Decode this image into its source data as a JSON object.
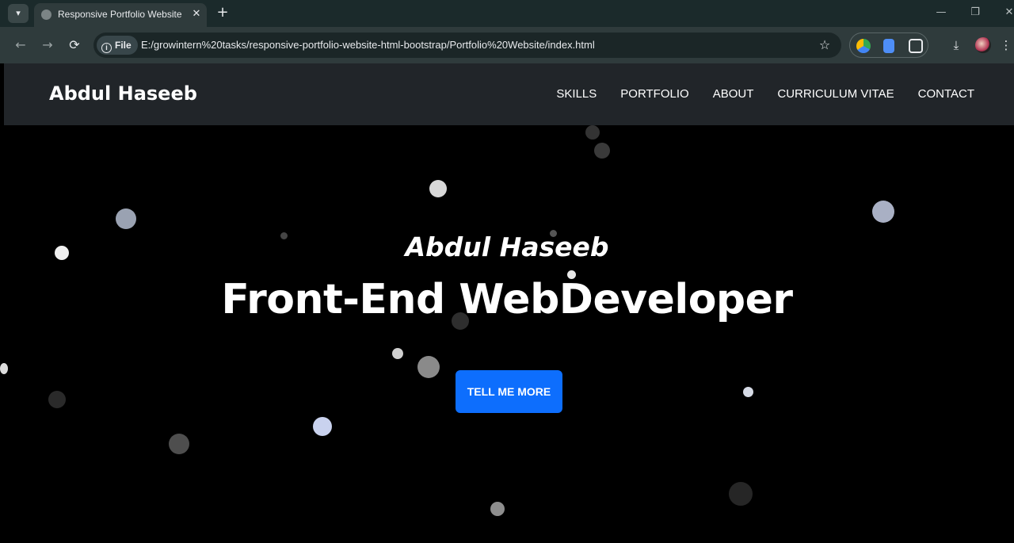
{
  "browser": {
    "tab_title": "Responsive Portfolio Website | C",
    "tab_close": "✕",
    "new_tab": "+",
    "omnibox_chip": "File",
    "url": "E:/growintern%20tasks/responsive-portfolio-website-html-bootstrap/Portfolio%20Website/index.html",
    "icons": {
      "back": "←",
      "forward": "→",
      "reload": "⟳",
      "star": "☆",
      "download": "⤓",
      "menu": "⋮",
      "minimize": "—",
      "restore": "❐",
      "close": "✕"
    }
  },
  "site": {
    "brand": "Abdul Haseeb",
    "nav": [
      "SKILLS",
      "PORTFOLIO",
      "ABOUT",
      "CURRICULUM VITAE",
      "CONTACT"
    ],
    "hero_subtitle": "Abdul Haseeb",
    "hero_title": "Front-End WebDeveloper",
    "cta_label": "TELL ME MORE"
  },
  "colors": {
    "chrome_dark": "#1b2a2b",
    "chrome_toolbar": "#2f3b3c",
    "site_nav": "#212529",
    "page_bg": "#000000",
    "accent": "#0d6efd"
  }
}
